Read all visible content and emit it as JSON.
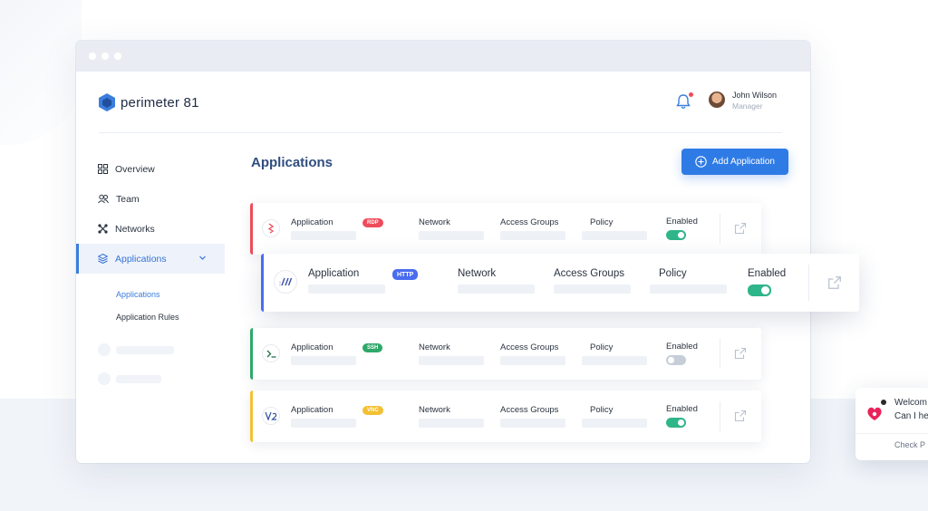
{
  "app": {
    "name": "perimeter 81"
  },
  "user": {
    "name": "John Wilson",
    "role": "Manager"
  },
  "sidebar": {
    "items": [
      {
        "label": "Overview",
        "icon": "grid-icon"
      },
      {
        "label": "Team",
        "icon": "users-icon"
      },
      {
        "label": "Networks",
        "icon": "network-icon"
      },
      {
        "label": "Applications",
        "icon": "layers-icon",
        "active": true
      }
    ],
    "subitems": [
      {
        "label": "Applications",
        "active": true
      },
      {
        "label": "Application Rules"
      }
    ]
  },
  "main": {
    "title": "Applications",
    "add_button": "Add Application",
    "rows": [
      {
        "app_label": "Application",
        "tag": "RDP",
        "tag_color": "#ef4b5a",
        "stripe": "#ef4b5a",
        "network": "Network",
        "groups": "Access Groups",
        "policy": "Policy",
        "enabled_label": "Enabled",
        "enabled": true,
        "icon": "rdp-icon"
      },
      {
        "app_label": "Application",
        "tag": "HTTP",
        "tag_color": "#4a6cf0",
        "stripe": "#4a6cf0",
        "network": "Network",
        "groups": "Access Groups",
        "policy": "Policy",
        "enabled_label": "Enabled",
        "enabled": true,
        "icon": "http-icon"
      },
      {
        "app_label": "Application",
        "tag": "SSH",
        "tag_color": "#2fa86a",
        "stripe": "#2fa86a",
        "network": "Network",
        "groups": "Access Groups",
        "policy": "Policy",
        "enabled_label": "Enabled",
        "enabled": false,
        "icon": "terminal-icon"
      },
      {
        "app_label": "Application",
        "tag": "VNC",
        "tag_color": "#f3c034",
        "stripe": "#f3c034",
        "network": "Network",
        "groups": "Access Groups",
        "policy": "Policy",
        "enabled_label": "Enabled",
        "enabled": true,
        "icon": "vnc-icon"
      }
    ]
  },
  "chat": {
    "line1": "Welcom",
    "line2": "Can I he",
    "cta": "Check P"
  },
  "colors": {
    "accent": "#2f7be6",
    "title": "#2f4e7f",
    "toggle_on": "#2fb58a"
  }
}
